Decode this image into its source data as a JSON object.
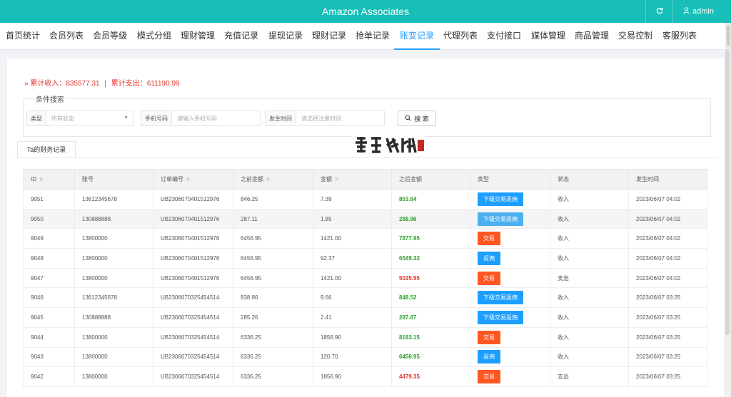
{
  "header": {
    "title": "Amazon Associates",
    "user": "admin"
  },
  "nav": {
    "tabs": [
      {
        "label": "首页统计"
      },
      {
        "label": "会员列表"
      },
      {
        "label": "会员等级"
      },
      {
        "label": "模式分组"
      },
      {
        "label": "理财管理"
      },
      {
        "label": "充值记录"
      },
      {
        "label": "提现记录"
      },
      {
        "label": "理财记录"
      },
      {
        "label": "抢单记录"
      },
      {
        "label": "账变记录"
      },
      {
        "label": "代理列表"
      },
      {
        "label": "支付接口"
      },
      {
        "label": "媒体管理"
      },
      {
        "label": "商品管理"
      },
      {
        "label": "交易控制"
      },
      {
        "label": "客服列表"
      }
    ],
    "active_index": 9
  },
  "summary": {
    "income_label": "累计收入：",
    "income_value": "835577.31",
    "separator": "|",
    "expense_label": "累计支出：",
    "expense_value": "611190.99"
  },
  "search": {
    "legend": "条件搜索",
    "type_label": "类型",
    "type_value": "所有状态",
    "phone_label": "手机号码",
    "phone_placeholder": "请输入手机号码",
    "time_label": "发生时间",
    "time_placeholder": "请选择注册时间",
    "button_label": "搜 索"
  },
  "subtab": {
    "label": "Ta的财务记录"
  },
  "table": {
    "columns": [
      "ID",
      "账号",
      "订单编号",
      "之前金额",
      "金额",
      "之后金额",
      "类型",
      "状态",
      "发生时间"
    ],
    "rows": [
      {
        "id": "9051",
        "account": "13612345678",
        "order": "UB2306070401512976",
        "before": "846.25",
        "amount": "7.39",
        "after": "853.64",
        "after_color": "green",
        "type": "下级交易返佣",
        "type_style": "blue",
        "status": "收入",
        "time": "2023/06/07 04:02"
      },
      {
        "id": "9050",
        "account": "130888888",
        "order": "UB2306070401512976",
        "before": "287.11",
        "amount": "1.85",
        "after": "288.96",
        "after_color": "green",
        "type": "下级交易返佣",
        "type_style": "light",
        "status": "收入",
        "time": "2023/06/07 04:02"
      },
      {
        "id": "9049",
        "account": "13800000",
        "order": "UB2306070401512976",
        "before": "6456.95",
        "amount": "1421.00",
        "after": "7877.95",
        "after_color": "green",
        "type": "交易",
        "type_style": "orange",
        "status": "收入",
        "time": "2023/06/07 04:02"
      },
      {
        "id": "9048",
        "account": "13800000",
        "order": "UB2306070401512976",
        "before": "6456.95",
        "amount": "92.37",
        "after": "6549.32",
        "after_color": "green",
        "type": "返佣",
        "type_style": "blue",
        "status": "收入",
        "time": "2023/06/07 04:02"
      },
      {
        "id": "9047",
        "account": "13800000",
        "order": "UB2306070401512976",
        "before": "6456.95",
        "amount": "1421.00",
        "after": "5035.95",
        "after_color": "red",
        "type": "交易",
        "type_style": "orange",
        "status": "支出",
        "time": "2023/06/07 04:02"
      },
      {
        "id": "9046",
        "account": "13612345678",
        "order": "UB2306070325454514",
        "before": "838.86",
        "amount": "9.66",
        "after": "848.52",
        "after_color": "green",
        "type": "下级交易返佣",
        "type_style": "blue",
        "status": "收入",
        "time": "2023/06/07 03:25"
      },
      {
        "id": "9045",
        "account": "130888888",
        "order": "UB2306070325454514",
        "before": "285.26",
        "amount": "2.41",
        "after": "287.67",
        "after_color": "green",
        "type": "下级交易返佣",
        "type_style": "blue",
        "status": "收入",
        "time": "2023/06/07 03:25"
      },
      {
        "id": "9044",
        "account": "13800000",
        "order": "UB2306070325454514",
        "before": "6336.25",
        "amount": "1856.90",
        "after": "8193.15",
        "after_color": "green",
        "type": "交易",
        "type_style": "orange",
        "status": "收入",
        "time": "2023/06/07 03:25"
      },
      {
        "id": "9043",
        "account": "13800000",
        "order": "UB2306070325454514",
        "before": "6336.25",
        "amount": "120.70",
        "after": "6456.95",
        "after_color": "green",
        "type": "返佣",
        "type_style": "blue",
        "status": "收入",
        "time": "2023/06/07 03:25"
      },
      {
        "id": "9042",
        "account": "13800000",
        "order": "UB2306070325454514",
        "before": "6336.25",
        "amount": "1856.90",
        "after": "4479.35",
        "after_color": "red",
        "type": "交易",
        "type_style": "orange",
        "status": "支出",
        "time": "2023/06/07 03:25"
      }
    ]
  },
  "colors": {
    "header_bg": "#17bfb8",
    "accent": "#1e9fff",
    "income_green": "#2da02d",
    "expense_red": "#e0322b",
    "tag_orange": "#ff5722"
  }
}
